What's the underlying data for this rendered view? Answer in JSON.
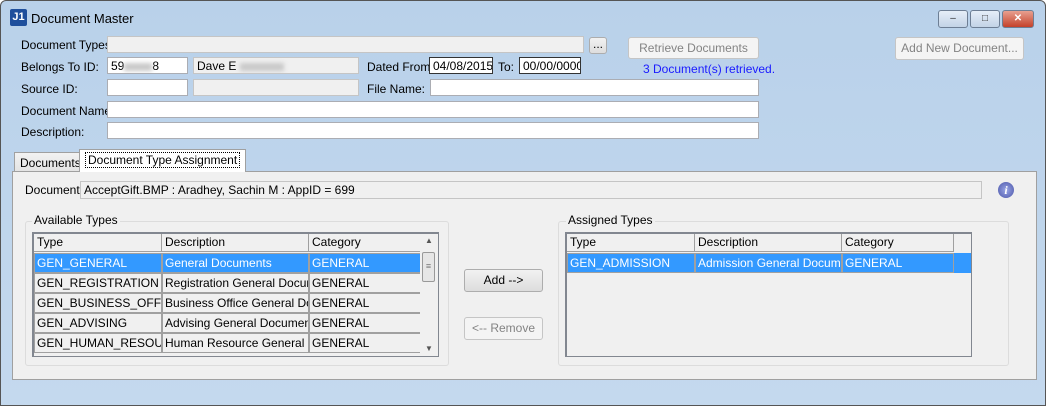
{
  "window": {
    "title": "Document Master",
    "logo": "J1",
    "minimize": "–",
    "maximize": "□",
    "close": "✕"
  },
  "form": {
    "document_types_label": "Document Types:",
    "document_types_value": "",
    "browse_label": "...",
    "retrieve_label": "Retrieve Documents",
    "status": "3 Document(s) retrieved.",
    "add_new_label": "Add New Document...",
    "belongs_to_label": "Belongs To ID:",
    "belongs_to_prefix": "59",
    "belongs_to_suffix": "8",
    "belongs_to_name": "Dave E",
    "dated_from_label": "Dated From:",
    "dated_from": "04/08/2015",
    "to_label": "To:",
    "to_value": "00/00/0000",
    "source_id_label": "Source ID:",
    "file_name_label": "File Name:",
    "document_name_label": "Document Name:",
    "description_label": "Description:"
  },
  "tabs": [
    {
      "label": "Documents"
    },
    {
      "label": "Document Type Assignment"
    }
  ],
  "assignment": {
    "document_label": "Document:",
    "document_value": "AcceptGift.BMP : Aradhey, Sachin M : AppID = 699",
    "available_title": "Available Types",
    "assigned_title": "Assigned Types",
    "add_label": "Add -->",
    "remove_label": "<-- Remove",
    "columns": [
      "Type",
      "Description",
      "Category"
    ],
    "available": [
      [
        "GEN_GENERAL",
        "General Documents",
        "GENERAL"
      ],
      [
        "GEN_REGISTRATION",
        "Registration General Documents",
        "GENERAL"
      ],
      [
        "GEN_BUSINESS_OFFICE",
        "Business Office General Documents",
        "GENERAL"
      ],
      [
        "GEN_ADVISING",
        "Advising General Documents",
        "GENERAL"
      ],
      [
        "GEN_HUMAN_RESOURCES",
        "Human Resource General Documents",
        "GENERAL"
      ]
    ],
    "assigned": [
      [
        "GEN_ADMISSION",
        "Admission General Documents",
        "GENERAL"
      ]
    ],
    "selection_color": "#3399ff"
  }
}
